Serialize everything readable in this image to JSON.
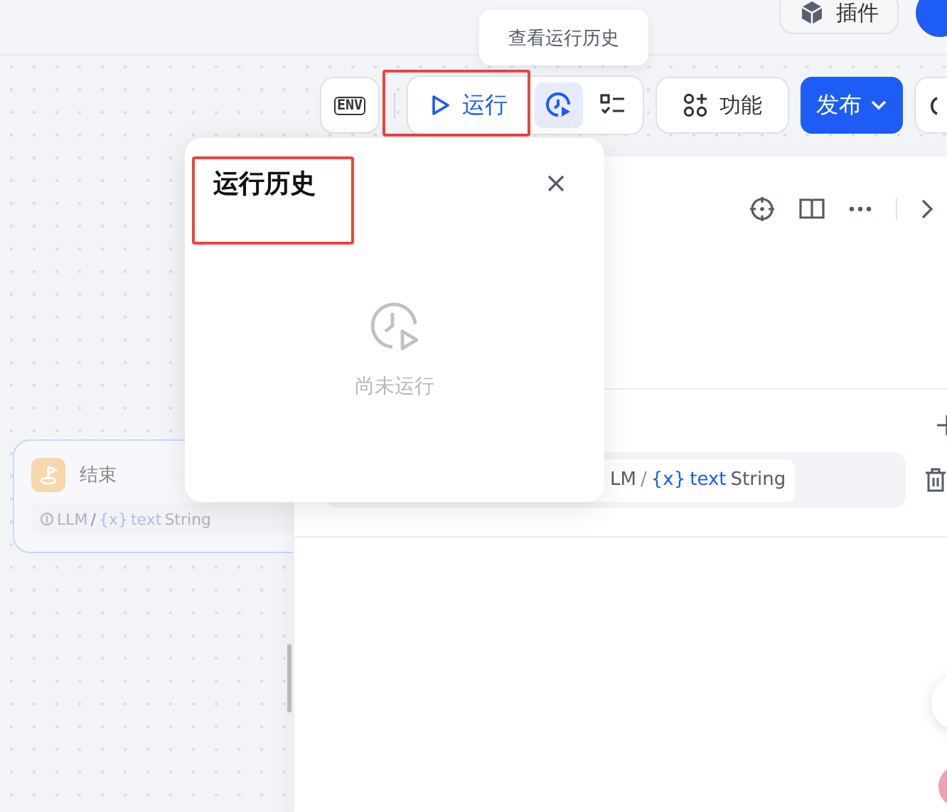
{
  "top_bar": {
    "plugin_button": "插件"
  },
  "tooltip": "查看运行历史",
  "toolbar": {
    "env_button": "ENV",
    "run_button": {
      "label": "运行",
      "highlighted": true
    },
    "history_button": {
      "selected": true
    },
    "features_button": "功能",
    "publish_button": "发布"
  },
  "end_node": {
    "title": "结束",
    "source": "LLM",
    "separator": "/",
    "variable": "{x}",
    "name": "text",
    "type": "String"
  },
  "side_panel": {
    "output_row": {
      "source": "LM",
      "separator": "/",
      "variable": "{x}",
      "name": "text",
      "type": "String"
    }
  },
  "history_popup": {
    "title": "运行历史",
    "highlighted": true,
    "empty_text": "尚未运行"
  }
}
